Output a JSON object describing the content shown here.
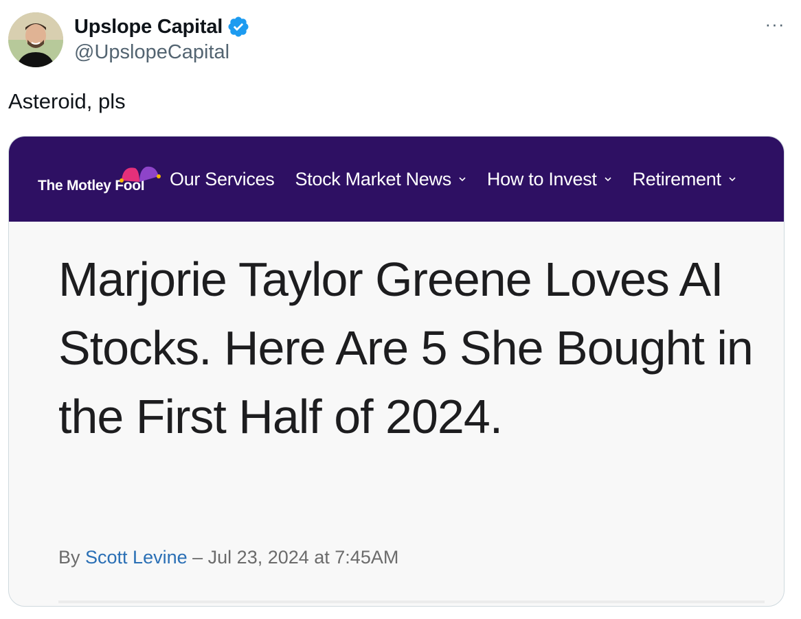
{
  "tweet": {
    "display_name": "Upslope Capital",
    "handle": "@UpslopeCapital",
    "more_label": "···",
    "text": "Asteroid, pls"
  },
  "article": {
    "site_brand": "The Motley Fool",
    "nav": [
      {
        "label": "Our Services",
        "has_dropdown": false
      },
      {
        "label": "Stock Market News",
        "has_dropdown": true
      },
      {
        "label": "How to Invest",
        "has_dropdown": true
      },
      {
        "label": "Retirement",
        "has_dropdown": true
      }
    ],
    "headline": "Marjorie Taylor Greene Loves AI Stocks. Here Are 5 She Bought in the First Half of 2024.",
    "byline_prefix": "By",
    "author": "Scott Levine",
    "byline_suffix": "– Jul 23, 2024 at 7:45AM"
  },
  "colors": {
    "nav_background": "#2e1063",
    "verified_badge": "#1d9bf0",
    "author_link": "#2a6fb5",
    "jester_pink": "#e5307a",
    "jester_purple": "#8e44c9",
    "jester_gold": "#f5b800"
  },
  "icons": {
    "verified": "verified-badge-icon",
    "more": "more-options-icon",
    "dropdown": "chevron-down-icon",
    "logo": "jester-hat-icon"
  }
}
